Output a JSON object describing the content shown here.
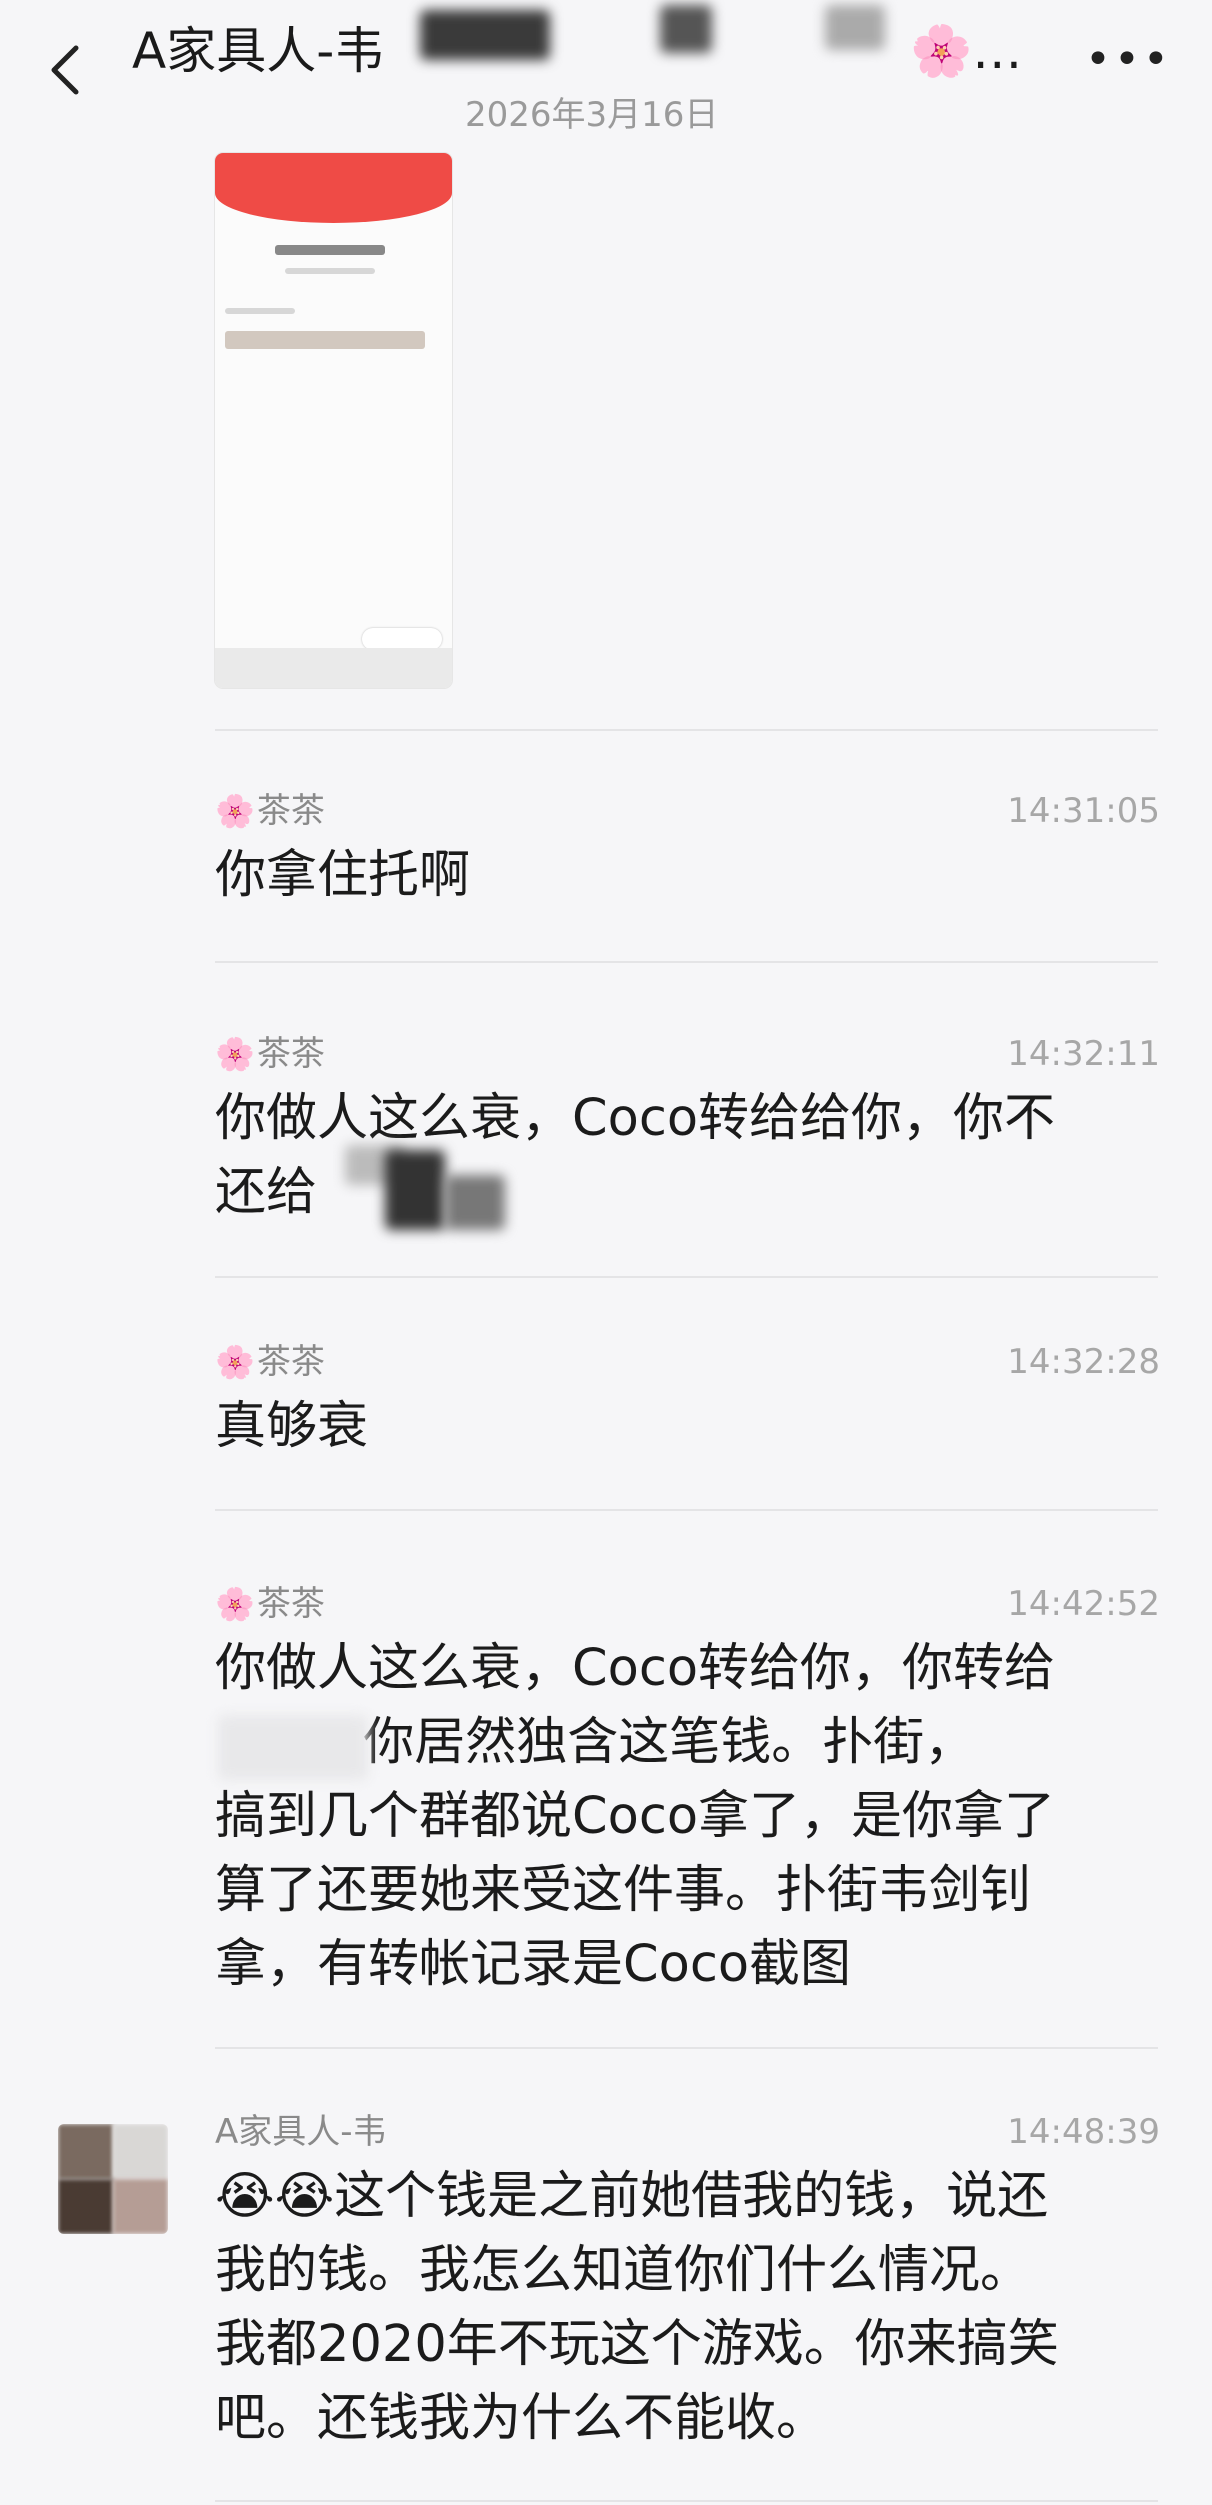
{
  "header": {
    "title": "A家具人-韦",
    "title_suffix": "🌸…",
    "more": "•••"
  },
  "date_separator": "2026年3月16日",
  "messages": [
    {
      "sender": "茶茶",
      "sender_icon": "🌸",
      "time": "14:31:05",
      "text": "你拿住托啊"
    },
    {
      "sender": "茶茶",
      "sender_icon": "🌸",
      "time": "14:32:11",
      "text": "你做人这么衰，Coco转给给你，你不\n还给"
    },
    {
      "sender": "茶茶",
      "sender_icon": "🌸",
      "time": "14:32:28",
      "text": "真够衰"
    },
    {
      "sender": "茶茶",
      "sender_icon": "🌸",
      "time": "14:42:52",
      "text": "你做人这么衰，Coco转给你，你转给\n      。你居然独含这笔钱。扑街，\n搞到几个群都说Coco拿了，是你拿了\n算了还要她来受这件事。扑街韦剑钊\n拿，有转帐记录是Coco截图"
    },
    {
      "sender": "A家具人-韦",
      "sender_icon": "",
      "time": "14:48:39",
      "text": "😭😭这个钱是之前她借我的钱，说还\n我的钱。我怎么知道你们什么情况。\n我都2020年不玩这个游戏。你来搞笑\n吧。还钱我为什么不能收。"
    }
  ]
}
